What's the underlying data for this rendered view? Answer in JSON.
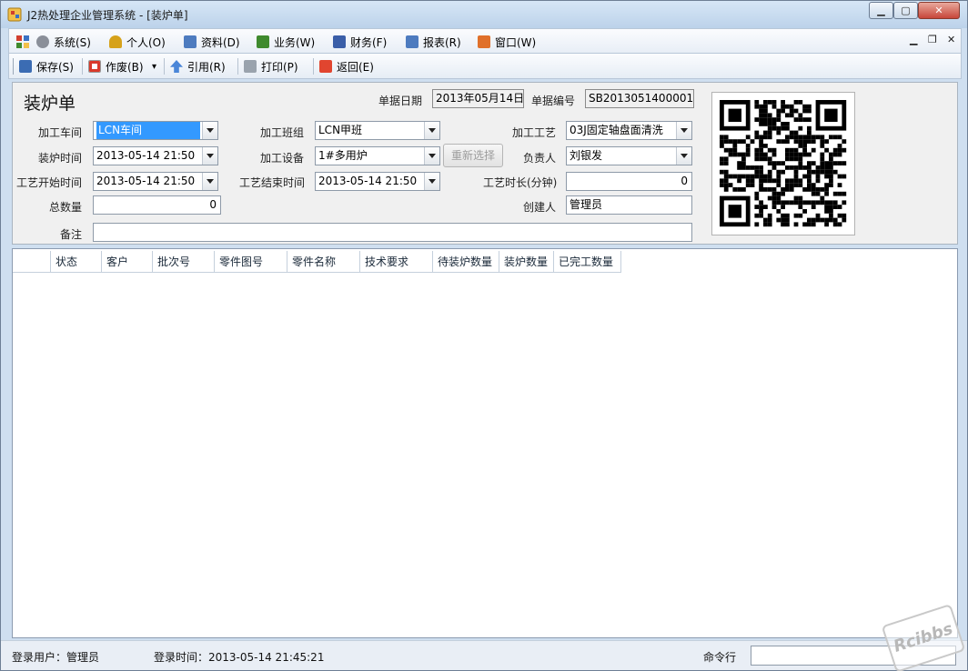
{
  "window": {
    "title": "J2热处理企业管理系统 - [装炉单]"
  },
  "window_controls": {
    "minimize": "▁",
    "maximize": "▢",
    "close": "✕"
  },
  "menu": [
    {
      "label": "系统(S)",
      "icon": "gear-icon",
      "color": "#8a8f99"
    },
    {
      "label": "个人(O)",
      "icon": "user-icon",
      "color": "#d6a21b"
    },
    {
      "label": "资料(D)",
      "icon": "card-icon",
      "color": "#4d7bbf"
    },
    {
      "label": "业务(W)",
      "icon": "exchange-icon",
      "color": "#3f8a2e"
    },
    {
      "label": "财务(F)",
      "icon": "bar-chart-icon",
      "color": "#3a5ea8"
    },
    {
      "label": "报表(R)",
      "icon": "table-icon",
      "color": "#4d7bbf"
    },
    {
      "label": "窗口(W)",
      "icon": "windows-icon",
      "color": "#e0702a"
    }
  ],
  "mdi_controls": {
    "minimize": "▁",
    "restore": "❐",
    "close": "✕"
  },
  "toolbar": {
    "save": "保存(S)",
    "void": "作废(B)",
    "void_more": "▾",
    "quote": "引用(R)",
    "print": "打印(P)",
    "back": "返回(E)"
  },
  "form": {
    "title": "装炉单",
    "doc_date_label": "单据日期",
    "doc_date": "2013年05月14日",
    "doc_no_label": "单据编号",
    "doc_no": "SB2013051400001",
    "workshop_label": "加工车间",
    "workshop": "LCN车间",
    "team_label": "加工班组",
    "team": "LCN甲班",
    "process_label": "加工工艺",
    "process": "03J固定轴盘面清洗",
    "load_time_label": "装炉时间",
    "load_time": "2013-05-14 21:50",
    "equipment_label": "加工设备",
    "equipment": "1#多用炉",
    "reselect_button": "重新选择",
    "owner_label": "负责人",
    "owner": "刘银发",
    "start_time_label": "工艺开始时间",
    "start_time": "2013-05-14 21:50",
    "end_time_label": "工艺结束时间",
    "end_time": "2013-05-14 21:50",
    "duration_label": "工艺时长(分钟)",
    "duration": "0",
    "total_qty_label": "总数量",
    "total_qty": "0",
    "creator_label": "创建人",
    "creator": "管理员",
    "remark_label": "备注",
    "remark": ""
  },
  "grid": {
    "columns": [
      "",
      "状态",
      "客户",
      "批次号",
      "零件图号",
      "零件名称",
      "技术要求",
      "待装炉数量",
      "装炉数量",
      "已完工数量"
    ]
  },
  "status": {
    "user": "登录用户：管理员",
    "login_time": "登录时间：2013-05-14 21:45:21",
    "cmd_label": "命令行"
  },
  "watermark": "Rcibbs"
}
